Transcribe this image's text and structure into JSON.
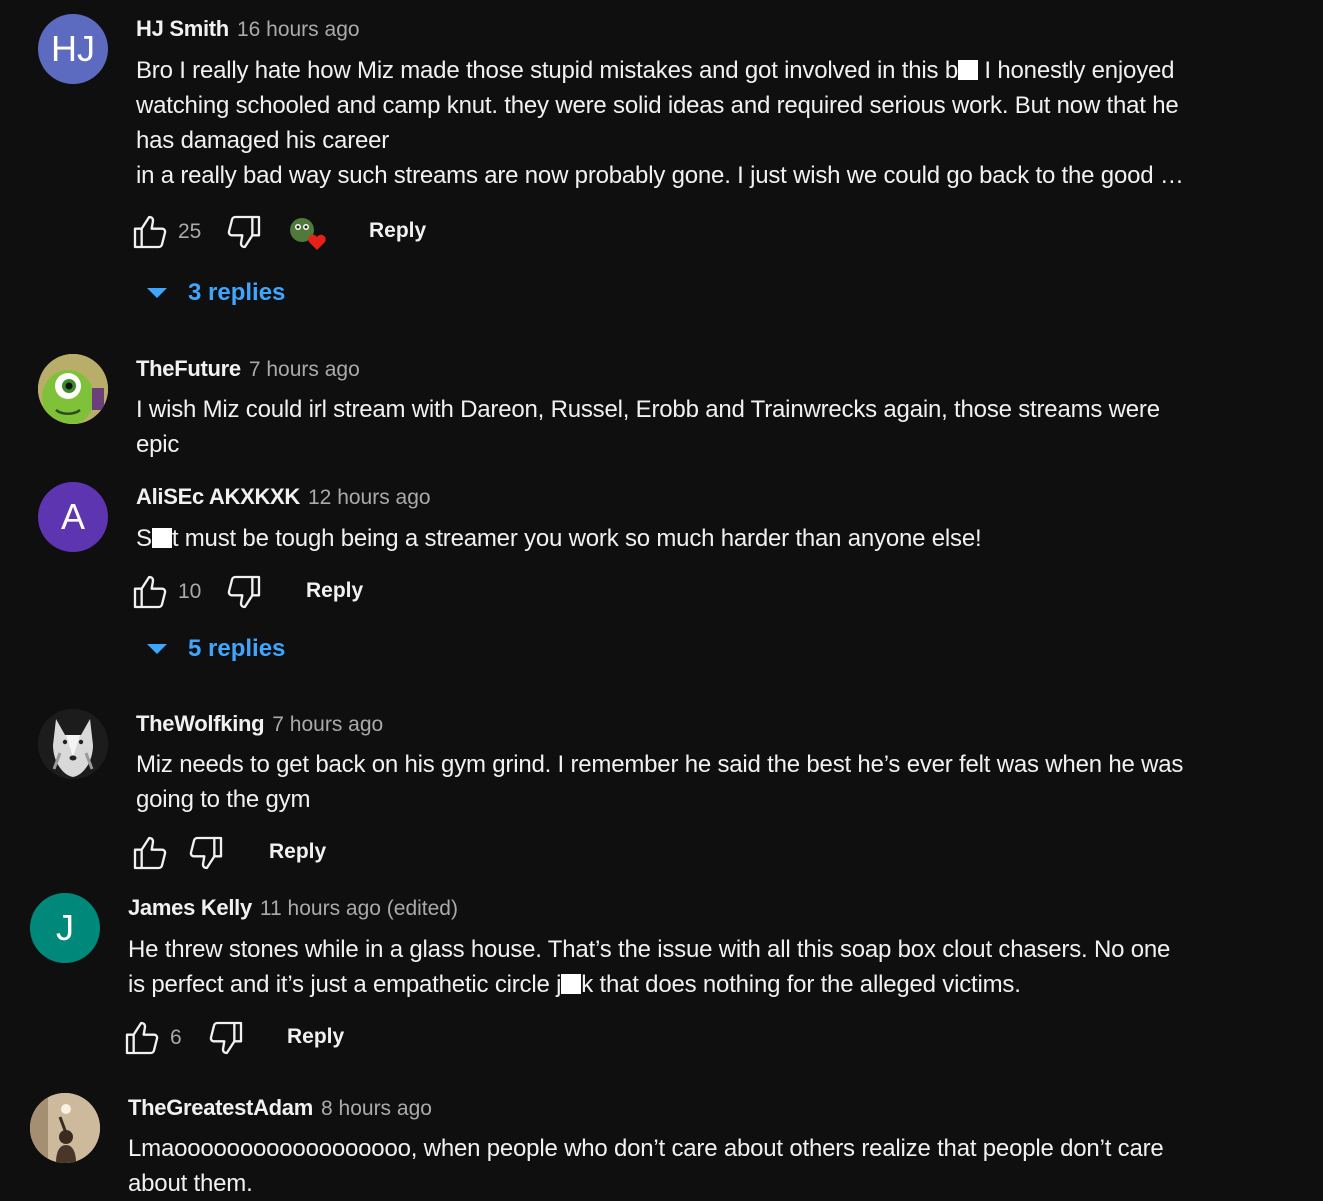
{
  "colors": {
    "background": "#0f0f0f",
    "text_primary": "#f1f1f1",
    "text_secondary": "#aaaaaa",
    "link_blue": "#3ea6ff",
    "avatar_hj": "#5c6bc0",
    "avatar_a": "#5e35b1",
    "avatar_j": "#00897b"
  },
  "comments": [
    {
      "author": "HJ Smith",
      "time": "16 hours ago",
      "avatar_text": "HJ",
      "lines": [
        "Bro I really hate how Miz made those stupid mistakes and got involved in this b",
        " I honestly enjoyed",
        "watching schooled and camp knut. they were solid ideas and required serious work. But now that he",
        "has damaged his career",
        "in a really bad way such streams are now probably gone. I just wish we could go back to the good …"
      ],
      "likes": "25",
      "reply_label": "Reply",
      "replies_label": "3 replies"
    },
    {
      "author": "TheFuture",
      "time": "7 hours ago",
      "lines": [
        "I wish Miz could irl stream with Dareon, Russel, Erobb and Trainwrecks again, those streams were",
        "epic"
      ]
    },
    {
      "author": "AliSEc AKXKXK",
      "time": "12 hours ago",
      "avatar_text": "A",
      "lines": [
        "S",
        "t must be tough being a streamer you work so much harder than anyone else!"
      ],
      "likes": "10",
      "reply_label": "Reply",
      "replies_label": "5 replies"
    },
    {
      "author": "TheWolfking",
      "time": "7 hours ago",
      "lines": [
        "Miz needs to get back on his gym grind. I remember he said the best he’s ever felt was when he was",
        "going to the gym"
      ],
      "reply_label": "Reply"
    },
    {
      "author": "James Kelly",
      "time": "11 hours ago (edited)",
      "avatar_text": "J",
      "lines": [
        "He threw stones while in a glass house. That’s the issue with all this soap box clout chasers. No one",
        "is perfect and it’s just a empathetic circle j",
        "k that does nothing for the alleged victims."
      ],
      "likes": "6",
      "reply_label": "Reply"
    },
    {
      "author": "TheGreatestAdam",
      "time": "8 hours ago",
      "lines": [
        "Lmaoooooooooooooooooo, when people who don’t care about others realize that people don’t care",
        "about them."
      ]
    }
  ]
}
